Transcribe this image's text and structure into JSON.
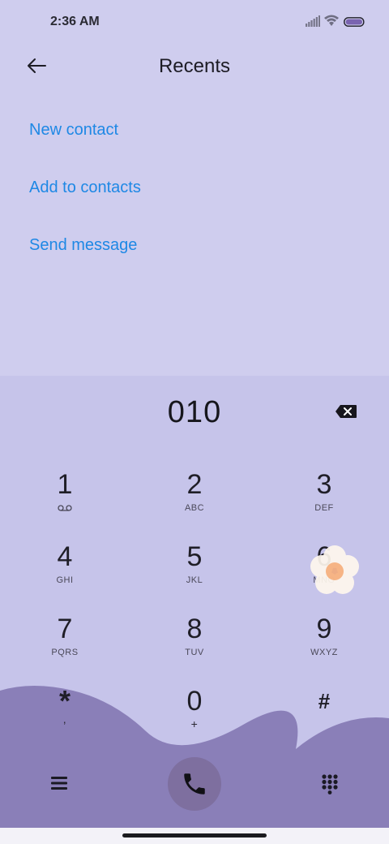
{
  "status_bar": {
    "time": "2:36 AM"
  },
  "header": {
    "title": "Recents"
  },
  "actions": [
    {
      "label": "New contact"
    },
    {
      "label": "Add to contacts"
    },
    {
      "label": "Send message"
    }
  ],
  "dialer": {
    "number": "010",
    "keys": [
      {
        "digit": "1",
        "sub": ""
      },
      {
        "digit": "2",
        "sub": "ABC"
      },
      {
        "digit": "3",
        "sub": "DEF"
      },
      {
        "digit": "4",
        "sub": "GHI"
      },
      {
        "digit": "5",
        "sub": "JKL"
      },
      {
        "digit": "6",
        "sub": "MNO"
      },
      {
        "digit": "7",
        "sub": "PQRS"
      },
      {
        "digit": "8",
        "sub": "TUV"
      },
      {
        "digit": "9",
        "sub": "WXYZ"
      },
      {
        "digit": "*",
        "sub": ","
      },
      {
        "digit": "0",
        "sub": "+"
      },
      {
        "digit": "#",
        "sub": ""
      }
    ]
  },
  "icons": {
    "back": "arrow-left-icon",
    "delete": "backspace-icon",
    "voicemail": "voicemail-icon",
    "menu": "menu-icon",
    "call": "phone-icon",
    "keypad": "keypad-icon",
    "signal": "signal-icon",
    "wifi": "wifi-icon",
    "battery": "battery-icon"
  },
  "colors": {
    "link": "#1e88e5",
    "top_bg": "#cfcdee",
    "pad_bg": "#c6c4ea",
    "wave": "#8a7fb8",
    "call_button": "#7e6f9f"
  }
}
